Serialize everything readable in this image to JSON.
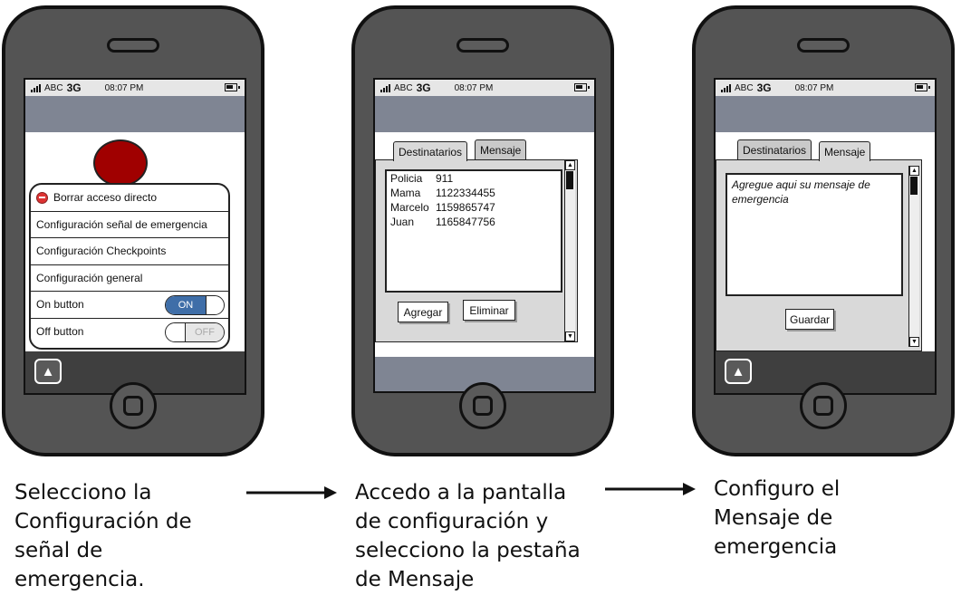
{
  "status_bar": {
    "carrier": "ABC",
    "network": "3G",
    "time": "08:07 PM"
  },
  "screen1": {
    "menu_items": [
      {
        "label": "Borrar acceso directo"
      },
      {
        "label": "Configuración señal de emergencia"
      },
      {
        "label": "Configuración Checkpoints"
      },
      {
        "label": "Configuración general"
      },
      {
        "label": "On button",
        "toggle": "ON"
      },
      {
        "label": "Off button",
        "toggle": "OFF"
      }
    ]
  },
  "screen2": {
    "tabs": [
      "Destinatarios",
      "Mensaje"
    ],
    "contacts": [
      {
        "name": "Policia",
        "phone": "911"
      },
      {
        "name": "Mama",
        "phone": "1122334455"
      },
      {
        "name": "Marcelo",
        "phone": "1159865747"
      },
      {
        "name": "Juan",
        "phone": "1165847756"
      }
    ],
    "add_button": "Agregar",
    "delete_button": "Eliminar"
  },
  "screen3": {
    "tabs": [
      "Destinatarios",
      "Mensaje"
    ],
    "message_text": "Agregue aqui su mensaje de emergencia",
    "save_button": "Guardar"
  },
  "captions": {
    "step1": [
      "Selecciono la",
      "Configuración de",
      "señal de",
      "emergencia."
    ],
    "step2": [
      "Accedo a la pantalla",
      "de configuración y",
      "selecciono la pestaña",
      "de Mensaje"
    ],
    "step3": [
      "Configuro el",
      "Mensaje de",
      "emergencia"
    ]
  },
  "colors": {
    "accent_red": "#a00000",
    "toggle_blue": "#3f6ea8",
    "title_bar": "#7f8593"
  }
}
